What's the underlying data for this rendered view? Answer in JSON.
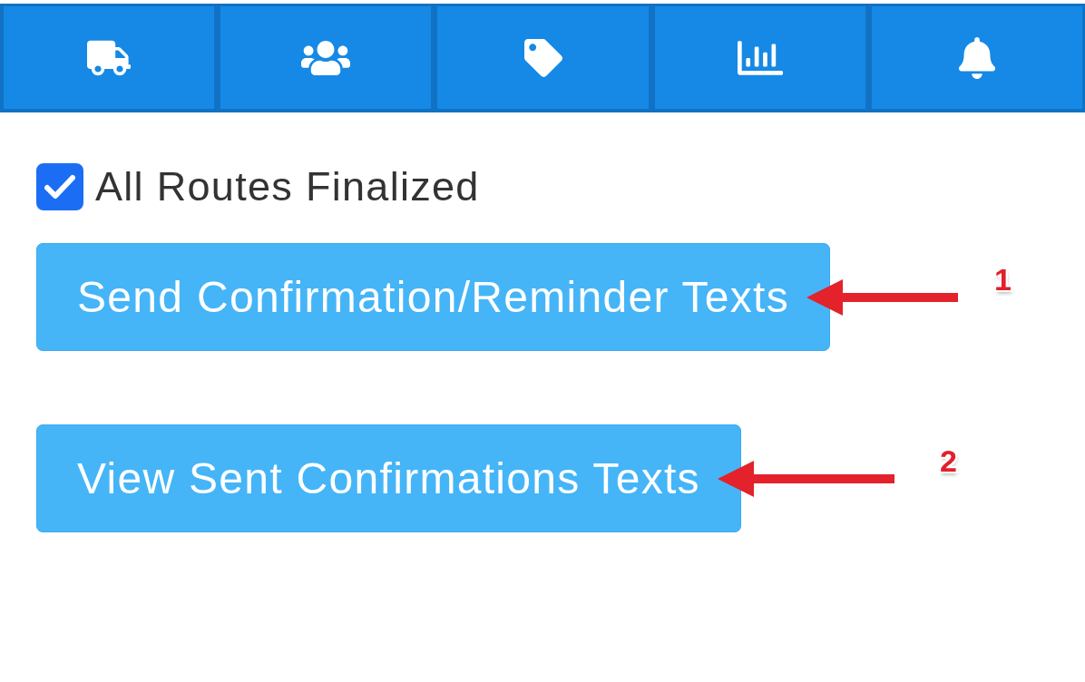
{
  "nav": {
    "tabs": [
      {
        "kind": "truck"
      },
      {
        "kind": "users"
      },
      {
        "kind": "tag"
      },
      {
        "kind": "chart"
      },
      {
        "kind": "bell"
      }
    ]
  },
  "finalized": {
    "label": "All Routes Finalized",
    "checked": true
  },
  "actions": [
    {
      "label": "Send Confirmation/Reminder Texts",
      "callout": "1"
    },
    {
      "label": "View Sent Confirmations Texts",
      "callout": "2"
    }
  ]
}
